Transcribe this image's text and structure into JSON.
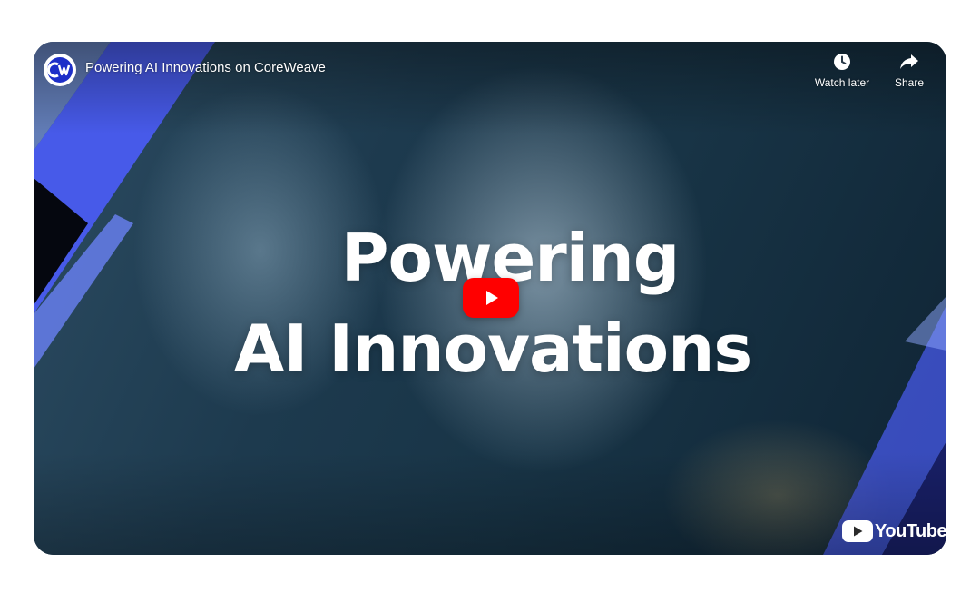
{
  "video": {
    "title": "Powering AI Innovations on CoreWeave",
    "channel_logo_text": "CW",
    "headline_line1": "Powering",
    "headline_line2": "AI Innovations"
  },
  "actions": {
    "watch_later_label": "Watch later",
    "watch_later_icon": "clock-icon",
    "share_label": "Share",
    "share_icon": "share-arrow-icon"
  },
  "player": {
    "play_icon": "play-icon",
    "brand_logo_text": "YouTube",
    "brand_color": "#ff0000"
  },
  "theme": {
    "accent_blue": "#4a5cf5",
    "overlay_dark": "#1b3346"
  }
}
